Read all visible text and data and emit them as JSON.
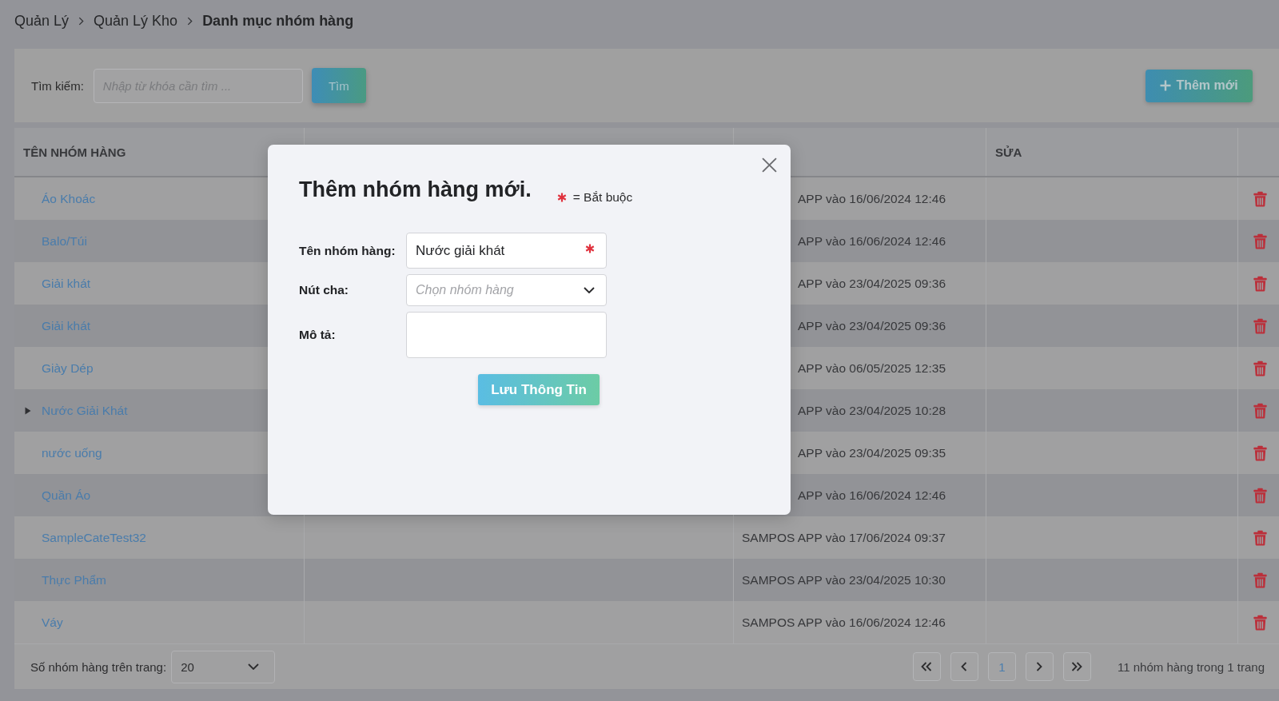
{
  "breadcrumb": [
    {
      "label": "Quản Lý",
      "current": false
    },
    {
      "label": "Quản Lý Kho",
      "current": false
    },
    {
      "label": "Danh mục nhóm hàng",
      "current": true
    }
  ],
  "search": {
    "label": "Tìm kiếm:",
    "placeholder": "Nhập từ khóa cần tìm ...",
    "button": "Tìm"
  },
  "add_button": {
    "label": "Thêm mới"
  },
  "table": {
    "columns": {
      "name": "TÊN NHÓM HÀNG",
      "edit": "SỬA"
    },
    "rows": [
      {
        "name": "Áo Khoác",
        "expandable": false,
        "expanded": false,
        "created": "APP vào 16/06/2024 12:46",
        "created_partly_hidden": true
      },
      {
        "name": "Balo/Túi",
        "expandable": false,
        "expanded": false,
        "created": "APP vào 16/06/2024 12:46",
        "created_partly_hidden": true
      },
      {
        "name": "Giải khát",
        "expandable": false,
        "expanded": false,
        "created": "APP vào 23/04/2025 09:36",
        "created_partly_hidden": true
      },
      {
        "name": "Giải khát",
        "expandable": false,
        "expanded": false,
        "created": "APP vào 23/04/2025 09:36",
        "created_partly_hidden": true
      },
      {
        "name": "Giày Dép",
        "expandable": false,
        "expanded": false,
        "created": "APP vào 06/05/2025 12:35",
        "created_partly_hidden": true
      },
      {
        "name": "Nước Giải Khát",
        "expandable": true,
        "expanded": false,
        "created": "APP vào 23/04/2025 10:28",
        "created_partly_hidden": true
      },
      {
        "name": "nước uống",
        "expandable": false,
        "expanded": false,
        "created": "APP vào 23/04/2025 09:35",
        "created_partly_hidden": true
      },
      {
        "name": "Quần Áo",
        "expandable": false,
        "expanded": false,
        "created": "APP vào 16/06/2024 12:46",
        "created_partly_hidden": true
      },
      {
        "name": "SampleCateTest32",
        "expandable": false,
        "expanded": false,
        "created": "SAMPOS APP vào 17/06/2024 09:37",
        "created_partly_hidden": false
      },
      {
        "name": "Thực Phẩm",
        "expandable": false,
        "expanded": false,
        "created": "SAMPOS APP vào 23/04/2025 10:30",
        "created_partly_hidden": false
      },
      {
        "name": "Váy",
        "expandable": false,
        "expanded": false,
        "created": "SAMPOS APP vào 16/06/2024 12:46",
        "created_partly_hidden": false
      }
    ]
  },
  "footer": {
    "page_size_label": "Số nhóm hàng trên trang:",
    "page_size": "20",
    "pages": [
      {
        "label": "1",
        "selected": true
      }
    ],
    "summary": "11 nhóm hàng trong 1 trang"
  },
  "dialog": {
    "title": "Thêm nhóm hàng mới.",
    "required_note": "= Bắt buộc",
    "fields": [
      {
        "kind": "text",
        "label": "Tên nhóm hàng:",
        "value": "Nước giải khát",
        "required": true
      },
      {
        "kind": "select",
        "label": "Nút cha:",
        "placeholder": "Chọn nhóm hàng",
        "required": false
      },
      {
        "kind": "textarea",
        "label": "Mô tả:",
        "required": false
      }
    ],
    "save_button": "Lưu Thông Tin"
  }
}
